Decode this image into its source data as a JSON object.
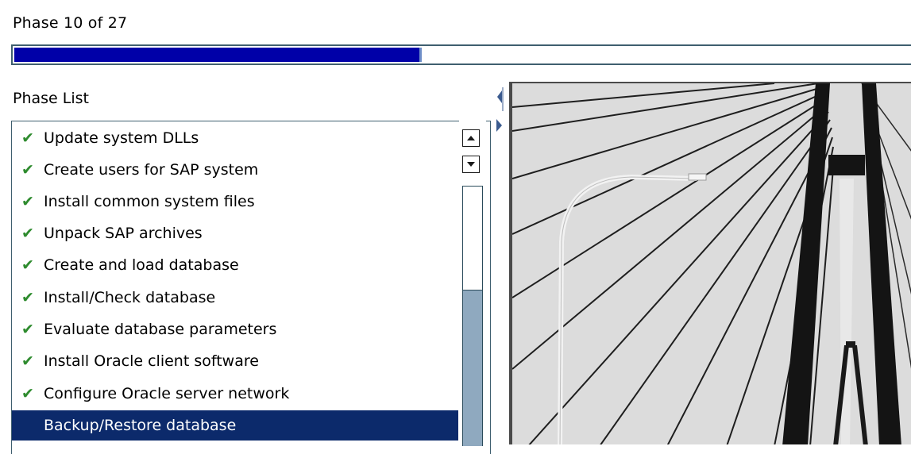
{
  "header": {
    "phase_status": "Phase 10 of 27",
    "progress_fraction": 0.45
  },
  "phase_list": {
    "label": "Phase List",
    "items": [
      {
        "label": "Update system DLLs",
        "status": "done"
      },
      {
        "label": "Create users for SAP system",
        "status": "done"
      },
      {
        "label": "Install common system files",
        "status": "done"
      },
      {
        "label": "Unpack SAP archives",
        "status": "done"
      },
      {
        "label": "Create and load database",
        "status": "done"
      },
      {
        "label": "Install/Check database",
        "status": "done"
      },
      {
        "label": "Evaluate database parameters",
        "status": "done"
      },
      {
        "label": "Install Oracle client software",
        "status": "done"
      },
      {
        "label": "Configure Oracle server network",
        "status": "done"
      },
      {
        "label": "Backup/Restore database",
        "status": "current"
      }
    ]
  },
  "colors": {
    "progress_fill": "#0000a8",
    "selected_row": "#0c2a6b",
    "check": "#2e8b2e"
  },
  "icons": {
    "done": "check-icon",
    "scroll_up": "triangle-up-icon",
    "scroll_down": "triangle-down-icon",
    "collapse_left": "triangle-left-icon",
    "expand_right": "triangle-right-icon"
  }
}
